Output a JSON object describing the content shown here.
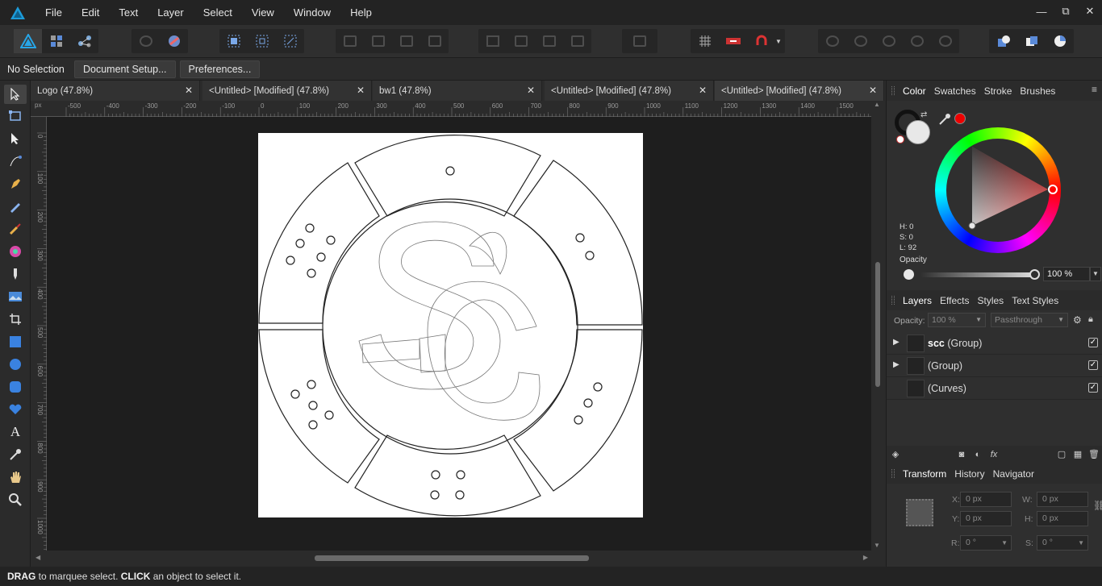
{
  "menubar": {
    "items": [
      "File",
      "Edit",
      "Text",
      "Layer",
      "Select",
      "View",
      "Window",
      "Help"
    ]
  },
  "window_controls": {
    "minimize": "—",
    "restore": "⧉",
    "close": "✕"
  },
  "context": {
    "selection": "No Selection",
    "document_setup": "Document Setup...",
    "preferences": "Preferences..."
  },
  "tabs": [
    {
      "label": "Logo (47.8%)",
      "active": false
    },
    {
      "label": "<Untitled> [Modified] (47.8%)",
      "active": false
    },
    {
      "label": "bw1 (47.8%)",
      "active": false
    },
    {
      "label": "<Untitled> [Modified] (47.8%)",
      "active": false
    },
    {
      "label": "<Untitled> [Modified] (47.8%)",
      "active": true
    }
  ],
  "ruler": {
    "unit": "px",
    "top_labels": [
      "-500",
      "-400",
      "-300",
      "-200",
      "-100",
      "0",
      "100",
      "200",
      "300",
      "400",
      "500",
      "600",
      "700",
      "800",
      "900",
      "1000",
      "1100",
      "1200",
      "1300",
      "1400",
      "1500"
    ],
    "left_labels": [
      "0",
      "100",
      "200",
      "300",
      "400",
      "500",
      "600",
      "700",
      "800",
      "900",
      "1000"
    ]
  },
  "right_panel": {
    "color_tabs": [
      "Color",
      "Swatches",
      "Stroke",
      "Brushes"
    ],
    "hsl": {
      "h": "H: 0",
      "s": "S: 0",
      "l": "L: 92"
    },
    "opacity_label": "Opacity",
    "opacity_value": "100 %",
    "fill_color": "#e8e8e8",
    "picker_color": "#ff0000",
    "layers_tabs": [
      "Layers",
      "Effects",
      "Styles",
      "Text Styles"
    ],
    "layers_opacity_label": "Opacity:",
    "layers_opacity_value": "100 %",
    "blend_mode": "Passthrough",
    "layers": [
      {
        "name_bold": "scc",
        "name_rest": " (Group)",
        "expandable": true,
        "visible": true
      },
      {
        "name_bold": "",
        "name_rest": "(Group)",
        "expandable": true,
        "visible": true
      },
      {
        "name_bold": "",
        "name_rest": "(Curves)",
        "expandable": false,
        "visible": true
      }
    ],
    "transform_tabs": [
      "Transform",
      "History",
      "Navigator"
    ],
    "transform": {
      "x_label": "X:",
      "x": "0 px",
      "y_label": "Y:",
      "y": "0 px",
      "w_label": "W:",
      "w": "0 px",
      "h_label": "H:",
      "h": "0 px",
      "r_label": "R:",
      "r": "0 °",
      "s_label": "S:",
      "s": "0 °"
    }
  },
  "status": {
    "drag": "DRAG",
    "drag_text": " to marquee select. ",
    "click": "CLICK",
    "click_text": " an object to select it."
  }
}
